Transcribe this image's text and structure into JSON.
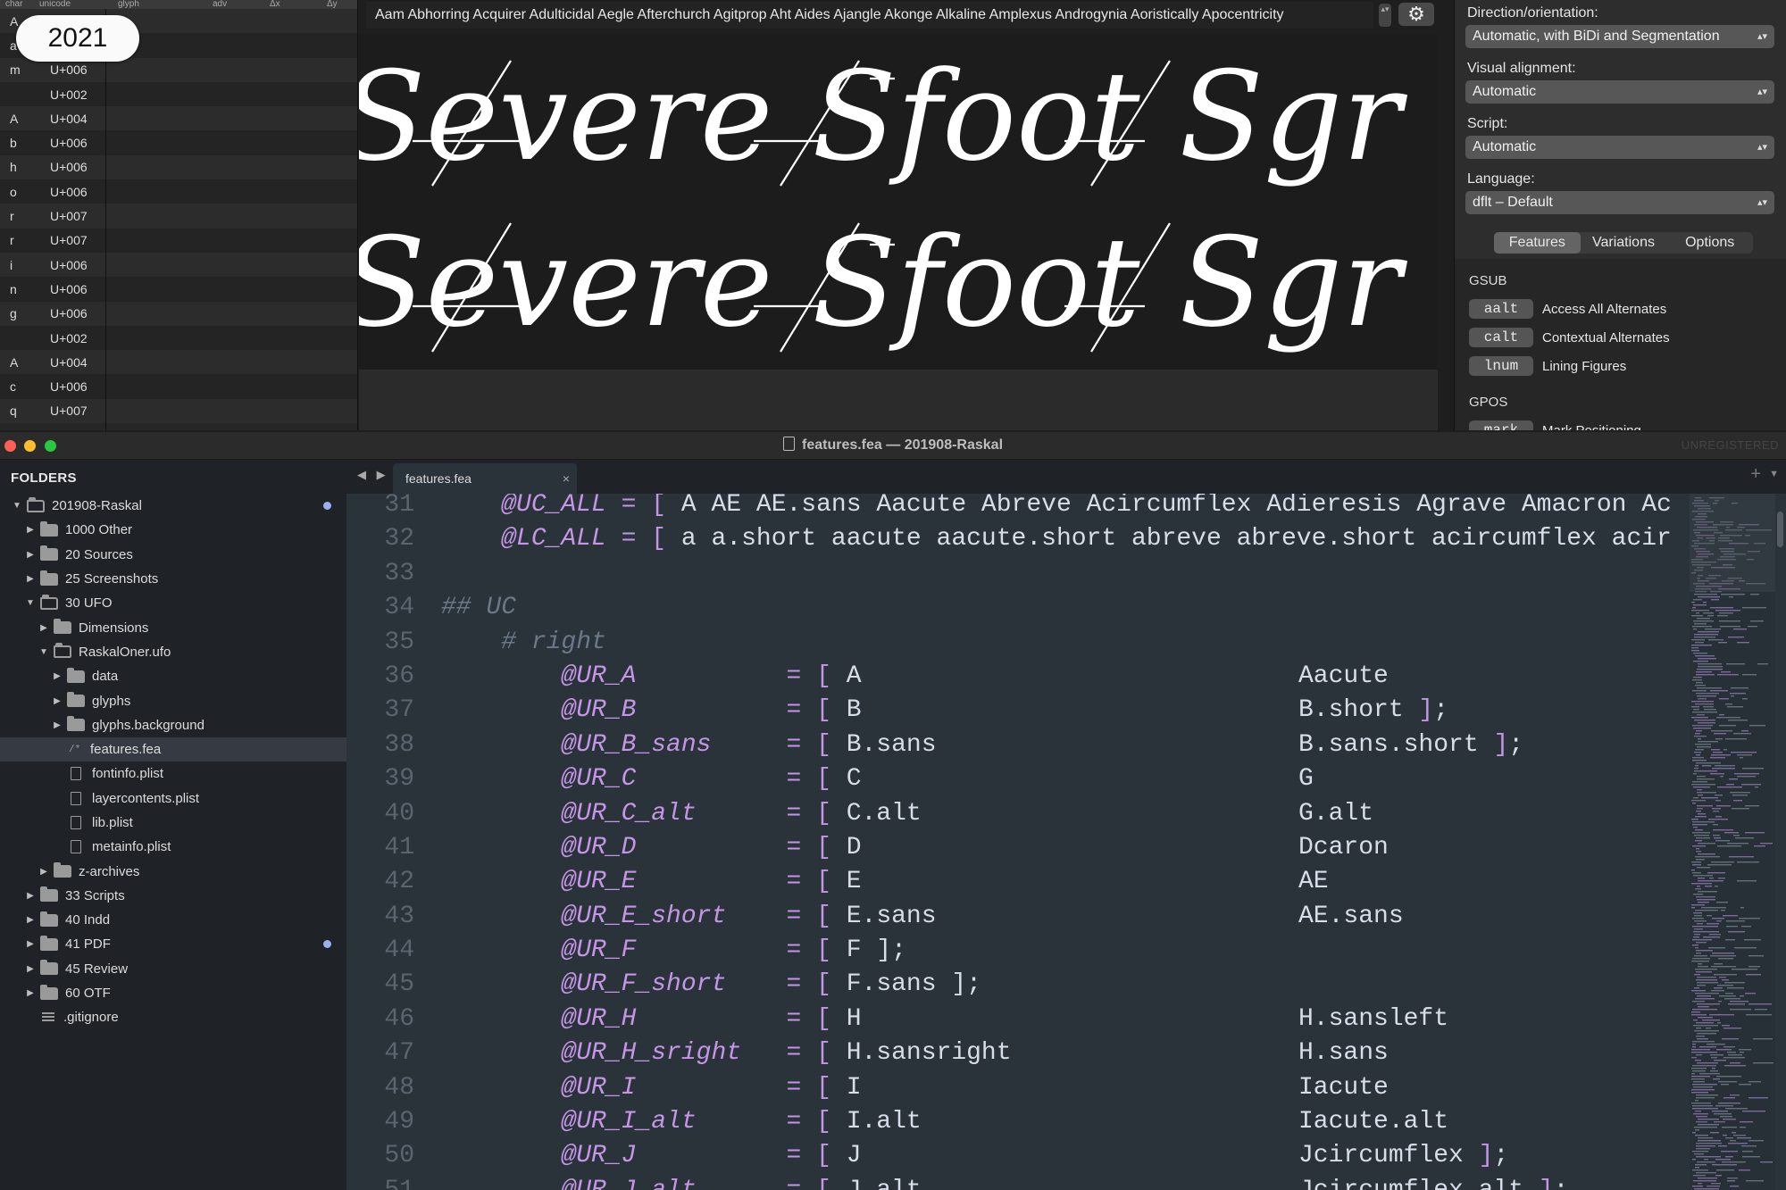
{
  "year_badge": "2021",
  "glyph_table": {
    "headers": [
      "char",
      "unicode",
      "glyph",
      "adv",
      "Δx",
      "Δy"
    ],
    "rows": [
      {
        "char": "A",
        "unicode": ""
      },
      {
        "char": "a",
        "unicode": ""
      },
      {
        "char": "m",
        "unicode": "U+006"
      },
      {
        "char": "",
        "unicode": "U+002"
      },
      {
        "char": "A",
        "unicode": "U+004"
      },
      {
        "char": "b",
        "unicode": "U+006"
      },
      {
        "char": "h",
        "unicode": "U+006"
      },
      {
        "char": "o",
        "unicode": "U+006"
      },
      {
        "char": "r",
        "unicode": "U+007"
      },
      {
        "char": "r",
        "unicode": "U+007"
      },
      {
        "char": "i",
        "unicode": "U+006"
      },
      {
        "char": "n",
        "unicode": "U+006"
      },
      {
        "char": "g",
        "unicode": "U+006"
      },
      {
        "char": "",
        "unicode": "U+002"
      },
      {
        "char": "A",
        "unicode": "U+004"
      },
      {
        "char": "c",
        "unicode": "U+006"
      },
      {
        "char": "q",
        "unicode": "U+007"
      }
    ]
  },
  "sample": {
    "text": "Aam Abhorring Acquirer Adulticidal Aegle Afterchurch Agitprop Aht Aides Ajangle Akonge Alkaline Amplexus Androgynia Aoristically Apocentricity",
    "stepper_glyph": "▴▾",
    "gear_glyph": "⚙"
  },
  "preview": {
    "line1": "Severe Sfoot Sgr",
    "line2": "Severe Sfoot Sgr",
    "text_color": "#ffffff",
    "bg_color": "#1c1c1c"
  },
  "inspector": {
    "direction_label": "Direction/orientation:",
    "direction_value": "Automatic, with BiDi and Segmentation",
    "alignment_label": "Visual alignment:",
    "alignment_value": "Automatic",
    "script_label": "Script:",
    "script_value": "Automatic",
    "language_label": "Language:",
    "language_value": "dflt – Default",
    "select_arrows": "▴▾",
    "tabs": [
      {
        "label": "Features",
        "active": true
      },
      {
        "label": "Variations",
        "active": false
      },
      {
        "label": "Options",
        "active": false
      }
    ],
    "gsub_title": "GSUB",
    "gsub_features": [
      {
        "tag": "aalt",
        "name": "Access All Alternates"
      },
      {
        "tag": "calt",
        "name": "Contextual Alternates"
      },
      {
        "tag": "lnum",
        "name": "Lining Figures"
      }
    ],
    "gpos_title": "GPOS",
    "gpos_features": [
      {
        "tag": "mark",
        "name": "Mark Positioning"
      }
    ]
  },
  "editor": {
    "window_title": "features.fea — 201908-Raskal",
    "unregistered": "UNREGISTERED",
    "traffic_colors": [
      "#fe5f57",
      "#febc2e",
      "#28c840"
    ],
    "sidebar_title": "FOLDERS",
    "tree": [
      {
        "label": "201908-Raskal",
        "depth": 0,
        "type": "folder",
        "open": true,
        "dot": true
      },
      {
        "label": "1000 Other",
        "depth": 1,
        "type": "folder",
        "open": false
      },
      {
        "label": "20 Sources",
        "depth": 1,
        "type": "folder",
        "open": false
      },
      {
        "label": "25 Screenshots",
        "depth": 1,
        "type": "folder",
        "open": false
      },
      {
        "label": "30 UFO",
        "depth": 1,
        "type": "folder",
        "open": true
      },
      {
        "label": "Dimensions",
        "depth": 2,
        "type": "folder",
        "open": false
      },
      {
        "label": "RaskalOner.ufo",
        "depth": 2,
        "type": "folder",
        "open": true
      },
      {
        "label": "data",
        "depth": 3,
        "type": "folder",
        "open": false
      },
      {
        "label": "glyphs",
        "depth": 3,
        "type": "folder",
        "open": false
      },
      {
        "label": "glyphs.background",
        "depth": 3,
        "type": "folder",
        "open": false
      },
      {
        "label": "features.fea",
        "depth": 3,
        "type": "code",
        "selected": true
      },
      {
        "label": "fontinfo.plist",
        "depth": 3,
        "type": "file"
      },
      {
        "label": "layercontents.plist",
        "depth": 3,
        "type": "file"
      },
      {
        "label": "lib.plist",
        "depth": 3,
        "type": "file"
      },
      {
        "label": "metainfo.plist",
        "depth": 3,
        "type": "file"
      },
      {
        "label": "z-archives",
        "depth": 2,
        "type": "folder",
        "open": false
      },
      {
        "label": "33 Scripts",
        "depth": 1,
        "type": "folder",
        "open": false
      },
      {
        "label": "40 Indd",
        "depth": 1,
        "type": "folder",
        "open": false
      },
      {
        "label": "41 PDF",
        "depth": 1,
        "type": "folder",
        "open": false,
        "dot": true
      },
      {
        "label": "45 Review",
        "depth": 1,
        "type": "folder",
        "open": false
      },
      {
        "label": "60 OTF",
        "depth": 1,
        "type": "folder",
        "open": false
      },
      {
        "label": ".gitignore",
        "depth": 1,
        "type": "lines"
      }
    ],
    "tab_label": "features.fea",
    "tab_close": "×",
    "tab_nav": "◀ ▶",
    "tab_plus": "+",
    "tab_menu": "▼",
    "code": [
      {
        "n": "31",
        "segs": [
          [
            "var",
            "    @UC_ALL"
          ],
          [
            "op",
            " = "
          ],
          [
            "br",
            "["
          ],
          [
            "txt",
            " A AE AE.sans Aacute Abreve Acircumflex Adieresis Agrave Amacron Ac"
          ]
        ]
      },
      {
        "n": "32",
        "segs": [
          [
            "var",
            "    @LC_ALL"
          ],
          [
            "op",
            " = "
          ],
          [
            "br",
            "["
          ],
          [
            "txt",
            " a a.short aacute aacute.short abreve abreve.short acircumflex acir"
          ]
        ]
      },
      {
        "n": "33",
        "segs": []
      },
      {
        "n": "34",
        "segs": [
          [
            "cmt",
            "## UC"
          ]
        ]
      },
      {
        "n": "35",
        "segs": [
          [
            "cmt",
            "    # right"
          ]
        ]
      },
      {
        "n": "36",
        "segs": [
          [
            "var",
            "        @UR_A"
          ],
          [
            "op",
            "          = "
          ],
          [
            "br",
            "["
          ],
          [
            "txt",
            " A"
          ]
        ],
        "col2": "Aacute"
      },
      {
        "n": "37",
        "segs": [
          [
            "var",
            "        @UR_B"
          ],
          [
            "op",
            "          = "
          ],
          [
            "br",
            "["
          ],
          [
            "txt",
            " B"
          ]
        ],
        "col2": "B.short ];"
      },
      {
        "n": "38",
        "segs": [
          [
            "var",
            "        @UR_B_sans"
          ],
          [
            "op",
            "     = "
          ],
          [
            "br",
            "["
          ],
          [
            "txt",
            " B.sans"
          ]
        ],
        "col2": "B.sans.short ];"
      },
      {
        "n": "39",
        "segs": [
          [
            "var",
            "        @UR_C"
          ],
          [
            "op",
            "          = "
          ],
          [
            "br",
            "["
          ],
          [
            "txt",
            " C"
          ]
        ],
        "col2": "G"
      },
      {
        "n": "40",
        "segs": [
          [
            "var",
            "        @UR_C_alt"
          ],
          [
            "op",
            "      = "
          ],
          [
            "br",
            "["
          ],
          [
            "txt",
            " C.alt"
          ]
        ],
        "col2": "G.alt"
      },
      {
        "n": "41",
        "segs": [
          [
            "var",
            "        @UR_D"
          ],
          [
            "op",
            "          = "
          ],
          [
            "br",
            "["
          ],
          [
            "txt",
            " D"
          ]
        ],
        "col2": "Dcaron"
      },
      {
        "n": "42",
        "segs": [
          [
            "var",
            "        @UR_E"
          ],
          [
            "op",
            "          = "
          ],
          [
            "br",
            "["
          ],
          [
            "txt",
            " E"
          ]
        ],
        "col2": "AE"
      },
      {
        "n": "43",
        "segs": [
          [
            "var",
            "        @UR_E_short"
          ],
          [
            "op",
            "    = "
          ],
          [
            "br",
            "["
          ],
          [
            "txt",
            " E.sans"
          ]
        ],
        "col2": "AE.sans"
      },
      {
        "n": "44",
        "segs": [
          [
            "var",
            "        @UR_F"
          ],
          [
            "op",
            "          = "
          ],
          [
            "br",
            "["
          ],
          [
            "txt",
            " F ];"
          ]
        ]
      },
      {
        "n": "45",
        "segs": [
          [
            "var",
            "        @UR_F_short"
          ],
          [
            "op",
            "    = "
          ],
          [
            "br",
            "["
          ],
          [
            "txt",
            " F.sans ];"
          ]
        ]
      },
      {
        "n": "46",
        "segs": [
          [
            "var",
            "        @UR_H"
          ],
          [
            "op",
            "          = "
          ],
          [
            "br",
            "["
          ],
          [
            "txt",
            " H"
          ]
        ],
        "col2": "H.sansleft"
      },
      {
        "n": "47",
        "segs": [
          [
            "var",
            "        @UR_H_sright"
          ],
          [
            "op",
            "   = "
          ],
          [
            "br",
            "["
          ],
          [
            "txt",
            " H.sansright"
          ]
        ],
        "col2": "H.sans"
      },
      {
        "n": "48",
        "segs": [
          [
            "var",
            "        @UR_I"
          ],
          [
            "op",
            "          = "
          ],
          [
            "br",
            "["
          ],
          [
            "txt",
            " I"
          ]
        ],
        "col2": "Iacute"
      },
      {
        "n": "49",
        "segs": [
          [
            "var",
            "        @UR_I_alt"
          ],
          [
            "op",
            "      = "
          ],
          [
            "br",
            "["
          ],
          [
            "txt",
            " I.alt"
          ]
        ],
        "col2": "Iacute.alt"
      },
      {
        "n": "50",
        "segs": [
          [
            "var",
            "        @UR_J"
          ],
          [
            "op",
            "          = "
          ],
          [
            "br",
            "["
          ],
          [
            "txt",
            " J"
          ]
        ],
        "col2": "Jcircumflex ];"
      },
      {
        "n": "51",
        "segs": [
          [
            "var",
            "        @UR_J_alt"
          ],
          [
            "op",
            "      = "
          ],
          [
            "br",
            "["
          ],
          [
            "txt",
            " J.alt"
          ]
        ],
        "col2": "Jcircumflex.alt ];"
      }
    ]
  }
}
